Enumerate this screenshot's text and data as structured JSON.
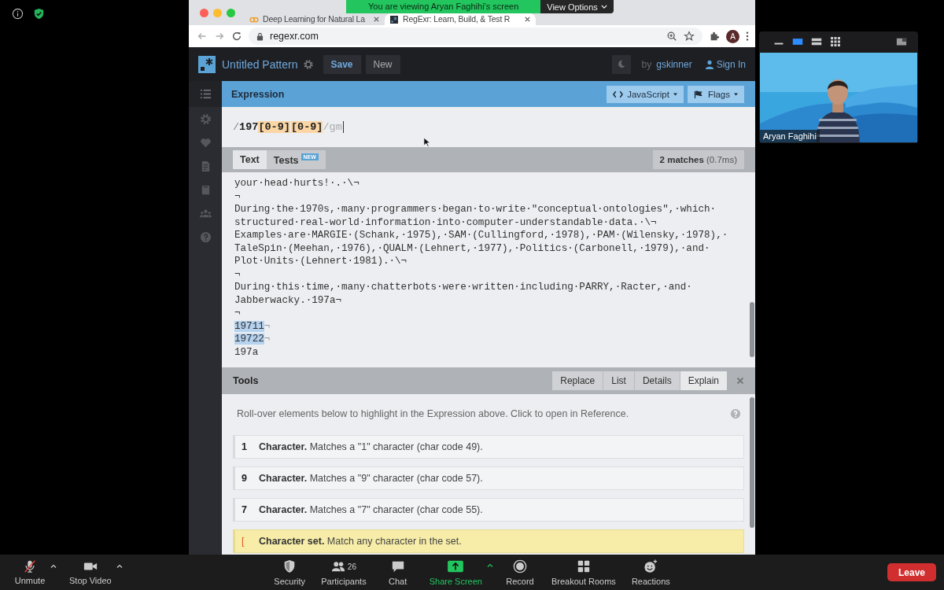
{
  "share_banner": {
    "text": "You are viewing Aryan Faghihi's screen",
    "button": "View Options"
  },
  "browser": {
    "tabs": [
      {
        "title": "Deep Learning for Natural La",
        "selected": false
      },
      {
        "title": "RegExr: Learn, Build, & Test R",
        "selected": true
      }
    ],
    "url": "regexr.com",
    "avatar": "A"
  },
  "regexr": {
    "pattern_name": "Untitled Pattern",
    "save": "Save",
    "new": "New",
    "by": "by",
    "author": "gskinner",
    "sign_in": "Sign In"
  },
  "sidebar": [
    {
      "kind": "list",
      "selected": true
    },
    {
      "kind": "gear",
      "selected": false
    },
    {
      "kind": "heart",
      "selected": false
    },
    {
      "kind": "document",
      "selected": false
    },
    {
      "kind": "book",
      "selected": false
    },
    {
      "kind": "people",
      "selected": false
    },
    {
      "kind": "help",
      "selected": false
    }
  ],
  "expression": {
    "title": "Expression",
    "engine": "JavaScript",
    "flags": "Flags",
    "tokens": [
      {
        "kind": "delimiter",
        "text": "/"
      },
      {
        "kind": "literal",
        "text": "197"
      },
      {
        "kind": "set",
        "text": "[0-9]"
      },
      {
        "kind": "set",
        "text": "[0-9]"
      },
      {
        "kind": "flags",
        "text": "/gm"
      }
    ]
  },
  "text_panel": {
    "tabs": [
      {
        "label": "Text",
        "selected": true
      },
      {
        "label": "Tests",
        "selected": false,
        "badge": "NEW"
      }
    ],
    "matches": "**2 matches** (0.7ms)",
    "lines": [
      {
        "text": "your·head·hurts!·.·\\¬",
        "matched": false
      },
      {
        "text": "¬",
        "matched": false
      },
      {
        "text": "During·the·1970s,·many·programmers·began·to·write·\"conceptual·ontologies\",·which·",
        "matched": false
      },
      {
        "text": "structured·real-world·information·into·computer-understandable·data.·\\¬",
        "matched": false
      },
      {
        "text": "Examples·are·MARGIE·(Schank,·1975),·SAM·(Cullingford,·1978),·PAM·(Wilensky,·1978),·",
        "matched": false
      },
      {
        "text": "TaleSpin·(Meehan,·1976),·QUALM·(Lehnert,·1977),·Politics·(Carbonell,·1979),·and·",
        "matched": false
      },
      {
        "text": "Plot·Units·(Lehnert·1981).·\\¬",
        "matched": false
      },
      {
        "text": "¬",
        "matched": false
      },
      {
        "text": "During·this·time,·many·chatterbots·were·written·including·PARRY,·Racter,·and·",
        "matched": false
      },
      {
        "text": "Jabberwacky.·197a¬",
        "matched": false
      },
      {
        "text": "¬",
        "matched": false
      },
      {
        "text": "19711",
        "matched": true,
        "end": "¬"
      },
      {
        "text": "19722",
        "matched": true,
        "end": "¬"
      },
      {
        "text": "197a",
        "matched": false
      }
    ]
  },
  "tools": {
    "title": "Tools",
    "tabs": [
      {
        "label": "Replace",
        "selected": false
      },
      {
        "label": "List",
        "selected": false
      },
      {
        "label": "Details",
        "selected": false
      },
      {
        "label": "Explain",
        "selected": true
      }
    ],
    "hint": "Roll-over elements below to highlight in the Expression above. Click to open in Reference.",
    "rows": [
      {
        "token": "1",
        "kind": "literal",
        "text": "**Character.** Matches a \"1\" character (char code 49).",
        "highlighted": false
      },
      {
        "token": "9",
        "kind": "literal",
        "text": "**Character.** Matches a \"9\" character (char code 57).",
        "highlighted": false
      },
      {
        "token": "7",
        "kind": "literal",
        "text": "**Character.** Matches a \"7\" character (char code 55).",
        "highlighted": false
      },
      {
        "token": "[",
        "kind": "set",
        "text": "**Character set.** Match any character in the set.",
        "highlighted": true
      }
    ]
  },
  "video": {
    "name": "Aryan Faghihi",
    "views": [
      {
        "kind": "minimize",
        "selected": false
      },
      {
        "kind": "speaker",
        "selected": true
      },
      {
        "kind": "strip",
        "selected": false
      },
      {
        "kind": "gallery",
        "selected": false
      }
    ]
  },
  "toolbar": {
    "left": [
      {
        "kind": "mic",
        "label": "Unmute",
        "caret": true,
        "highlighted": false
      },
      {
        "kind": "camera",
        "label": "Stop Video",
        "caret": true,
        "highlighted": false
      }
    ],
    "center": [
      {
        "kind": "security",
        "label": "Security",
        "highlighted": false
      },
      {
        "kind": "participants",
        "label": "Participants",
        "count": "26",
        "highlighted": false
      },
      {
        "kind": "chat",
        "label": "Chat",
        "highlighted": false
      },
      {
        "kind": "share",
        "label": "Share Screen",
        "caret": true,
        "highlighted": true
      },
      {
        "kind": "record",
        "label": "Record",
        "highlighted": false
      },
      {
        "kind": "breakout",
        "label": "Breakout Rooms",
        "highlighted": false
      },
      {
        "kind": "reactions",
        "label": "Reactions",
        "highlighted": false
      }
    ],
    "leave": "Leave"
  }
}
